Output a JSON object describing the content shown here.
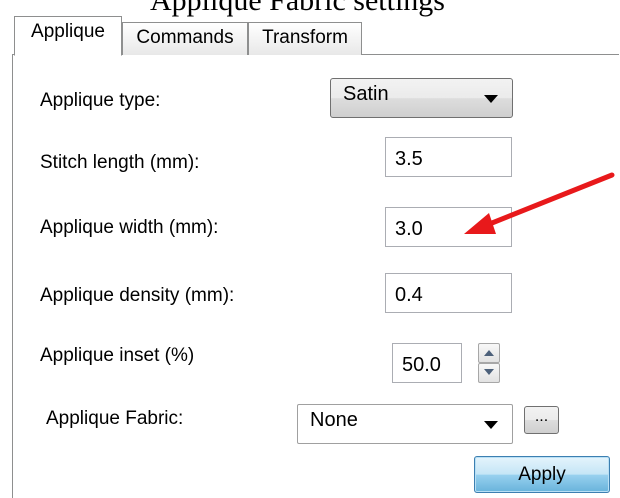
{
  "header_fragment": "Appliqué Fabric settings",
  "tabs": [
    {
      "label": "Applique",
      "active": true
    },
    {
      "label": "Commands",
      "active": false
    },
    {
      "label": "Transform",
      "active": false
    }
  ],
  "form": {
    "applique_type": {
      "label": "Applique type:",
      "value": "Satin"
    },
    "stitch_length": {
      "label": "Stitch length (mm):",
      "value": "3.5"
    },
    "applique_width": {
      "label": "Applique width (mm):",
      "value": "3.0"
    },
    "applique_density": {
      "label": "Applique density (mm):",
      "value": "0.4"
    },
    "applique_inset": {
      "label": "Applique inset (%)",
      "value": "50.0"
    },
    "applique_fabric": {
      "label": "Applique Fabric:",
      "value": "None"
    },
    "browse_label": "...",
    "apply_label": "Apply"
  },
  "colors": {
    "annotation_arrow": "#e8191b",
    "apply_button": "#98d1ef"
  },
  "icons": {
    "combo_arrow": "chevron-down-icon",
    "spin_up": "spin-up-icon",
    "spin_down": "spin-down-icon",
    "annotation": "red-arrow-icon"
  }
}
